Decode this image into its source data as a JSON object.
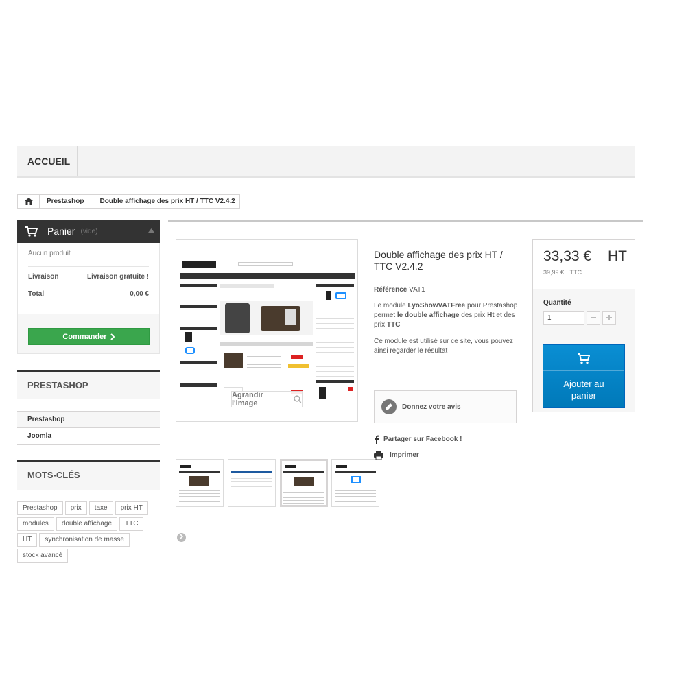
{
  "nav": {
    "home_label": "ACCUEIL"
  },
  "breadcrumb": {
    "category": "Prestashop",
    "current": "Double affichage des prix HT / TTC V2.4.2"
  },
  "cart": {
    "title": "Panier",
    "empty_label": "(vide)",
    "no_product": "Aucun produit",
    "shipping_label": "Livraison",
    "shipping_value": "Livraison gratuite !",
    "total_label": "Total",
    "total_value": "0,00 €",
    "checkout_label": "Commander"
  },
  "categories_block": {
    "title": "PRESTASHOP",
    "items": [
      "Prestashop",
      "Joomla"
    ]
  },
  "tags_block": {
    "title": "MOTS-CLÉS",
    "tags": [
      "Prestashop",
      "prix",
      "taxe",
      "prix HT",
      "modules",
      "double affichage",
      "TTC",
      "HT",
      "synchronisation de masse",
      "stock avancé"
    ]
  },
  "product": {
    "title": "Double affichage des prix HT / TTC V2.4.2",
    "reference_label": "Référence",
    "reference_value": "VAT1",
    "desc1_a": "Le module",
    "desc1_b": "LyoShowVATFree",
    "desc1_c": "pour Prestashop  permet",
    "desc1_d": "le double affichage",
    "desc1_e": "des prix",
    "desc1_f": "Ht",
    "desc1_g": "et des prix",
    "desc1_h": "TTC",
    "desc2": "Ce module est utilisé sur ce site, vous pouvez ainsi regarder le résultat",
    "review_label": "Donnez votre avis",
    "share_facebook": "Partager sur Facebook !",
    "print_label": "Imprimer",
    "zoom_label": "Agrandir l'image"
  },
  "pricing": {
    "price": "33,33 €",
    "tax_mode": "HT",
    "price_ttc": "39,99 €",
    "ttc_label": "TTC",
    "quantity_label": "Quantité",
    "quantity_value": "1",
    "add_to_cart_line1": "Ajouter au",
    "add_to_cart_line2": "panier"
  },
  "colors": {
    "accent_blue": "#0a8ed3",
    "accent_green": "#3aa64d",
    "dark": "#333333"
  }
}
